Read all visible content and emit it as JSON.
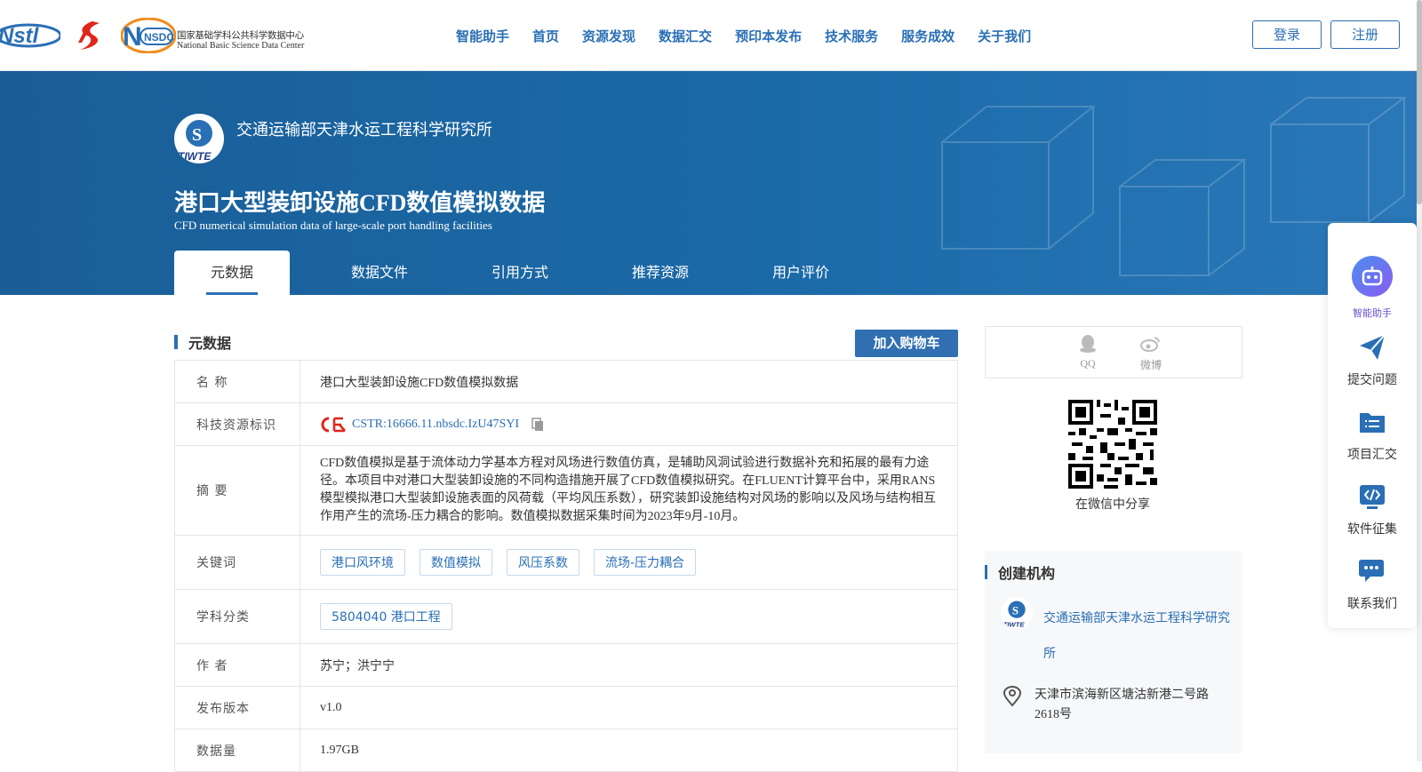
{
  "header": {
    "logos": {
      "nstl": "Nstl",
      "nsdc_badge": "NSDC",
      "nsdc_cn": "国家基础学科公共科学数据中心",
      "nsdc_en": "National Basic Science Data Center"
    },
    "nav": [
      "智能助手",
      "首页",
      "资源发现",
      "数据汇交",
      "预印本发布",
      "技术服务",
      "服务成效",
      "关于我们"
    ],
    "login_label": "登录",
    "register_label": "注册"
  },
  "banner": {
    "org_name": "交通运输部天津水运工程科学研究所",
    "title": "港口大型装卸设施CFD数值模拟数据",
    "subtitle": "CFD numerical simulation data of large-scale port handling facilities",
    "tabs": [
      "元数据",
      "数据文件",
      "引用方式",
      "推荐资源",
      "用户评价"
    ],
    "logo_text": "TIWTE"
  },
  "metadata": {
    "section_title": "元数据",
    "cart_button": "加入购物车",
    "labels": {
      "name": "名  称",
      "cstr": "科技资源标识",
      "abstract": "摘  要",
      "keywords": "关键词",
      "subject": "学科分类",
      "authors": "作  者",
      "version": "发布版本",
      "size": "数据量"
    },
    "values": {
      "name": "港口大型装卸设施CFD数值模拟数据",
      "cstr": "CSTR:16666.11.nbsdc.IzU47SYI",
      "abstract": "CFD数值模拟是基于流体动力学基本方程对风场进行数值仿真，是辅助风洞试验进行数据补充和拓展的最有力途径。本项目中对港口大型装卸设施的不同构造措施开展了CFD数值模拟研究。在FLUENT计算平台中，采用RANS模型模拟港口大型装卸设施表面的风荷载（平均风压系数），研究装卸设施结构对风场的影响以及风场与结构相互作用产生的流场-压力耦合的影响。数值模拟数据采集时间为2023年9月-10月。",
      "keywords": [
        "港口风环境",
        "数值模拟",
        "风压系数",
        "流场-压力耦合"
      ],
      "subject": "5804040 港口工程",
      "authors": "苏宁；洪宁宁",
      "version": "v1.0",
      "size": "1.97GB"
    }
  },
  "share": {
    "qq": "QQ",
    "weibo": "微博",
    "wechat_caption": "在微信中分享"
  },
  "creator": {
    "title": "创建机构",
    "org_link": "交通运输部天津水运工程科学研究所",
    "address": "天津市滨海新区塘沽新港二号路2618号"
  },
  "float_bar": {
    "ai": "智能助手",
    "submit": "提交问题",
    "projects": "项目汇交",
    "software": "软件征集",
    "contact": "联系我们"
  },
  "colors": {
    "primary": "#2a6fb5",
    "banner": "#1b6aa8",
    "cstr_logo": "#e1251b"
  }
}
